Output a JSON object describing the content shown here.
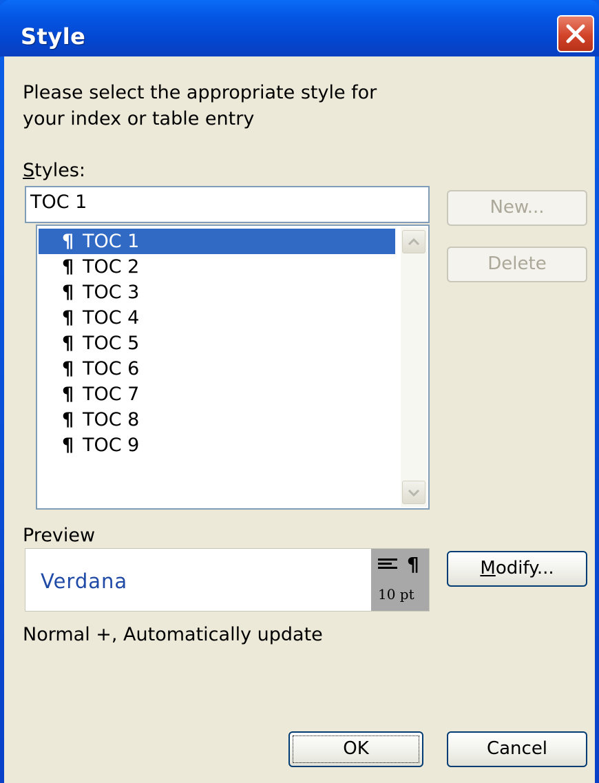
{
  "window": {
    "title": "Style"
  },
  "dialog": {
    "instruction": "Please select the appropriate style for your index or table entry",
    "styles_label_key": "S",
    "styles_label_rest": "tyles:",
    "style_input_value": "TOC 1",
    "styles_list": [
      {
        "label": "TOC 1",
        "selected": true
      },
      {
        "label": "TOC 2",
        "selected": false
      },
      {
        "label": "TOC 3",
        "selected": false
      },
      {
        "label": "TOC 4",
        "selected": false
      },
      {
        "label": "TOC 5",
        "selected": false
      },
      {
        "label": "TOC 6",
        "selected": false
      },
      {
        "label": "TOC 7",
        "selected": false
      },
      {
        "label": "TOC 8",
        "selected": false
      },
      {
        "label": "TOC 9",
        "selected": false
      }
    ],
    "paragraph_mark": "¶",
    "preview_label": "Preview",
    "preview_font": "Verdana",
    "preview_size": "10 pt",
    "description": "Normal +, Automatically update"
  },
  "buttons": {
    "new": "New...",
    "delete": "Delete",
    "modify_key": "M",
    "modify_rest": "odify...",
    "ok": "OK",
    "cancel": "Cancel"
  },
  "colors": {
    "titlebar": "#0347d0",
    "dialog_bg": "#ece9d8",
    "selection": "#316ac5",
    "preview_text": "#1f4aa6"
  },
  "icons": {
    "close": "close-icon",
    "scroll_up": "scroll-up-arrow-icon",
    "scroll_down": "scroll-down-arrow-icon",
    "align_left": "align-left-icon",
    "paragraph": "paragraph-mark-icon"
  }
}
